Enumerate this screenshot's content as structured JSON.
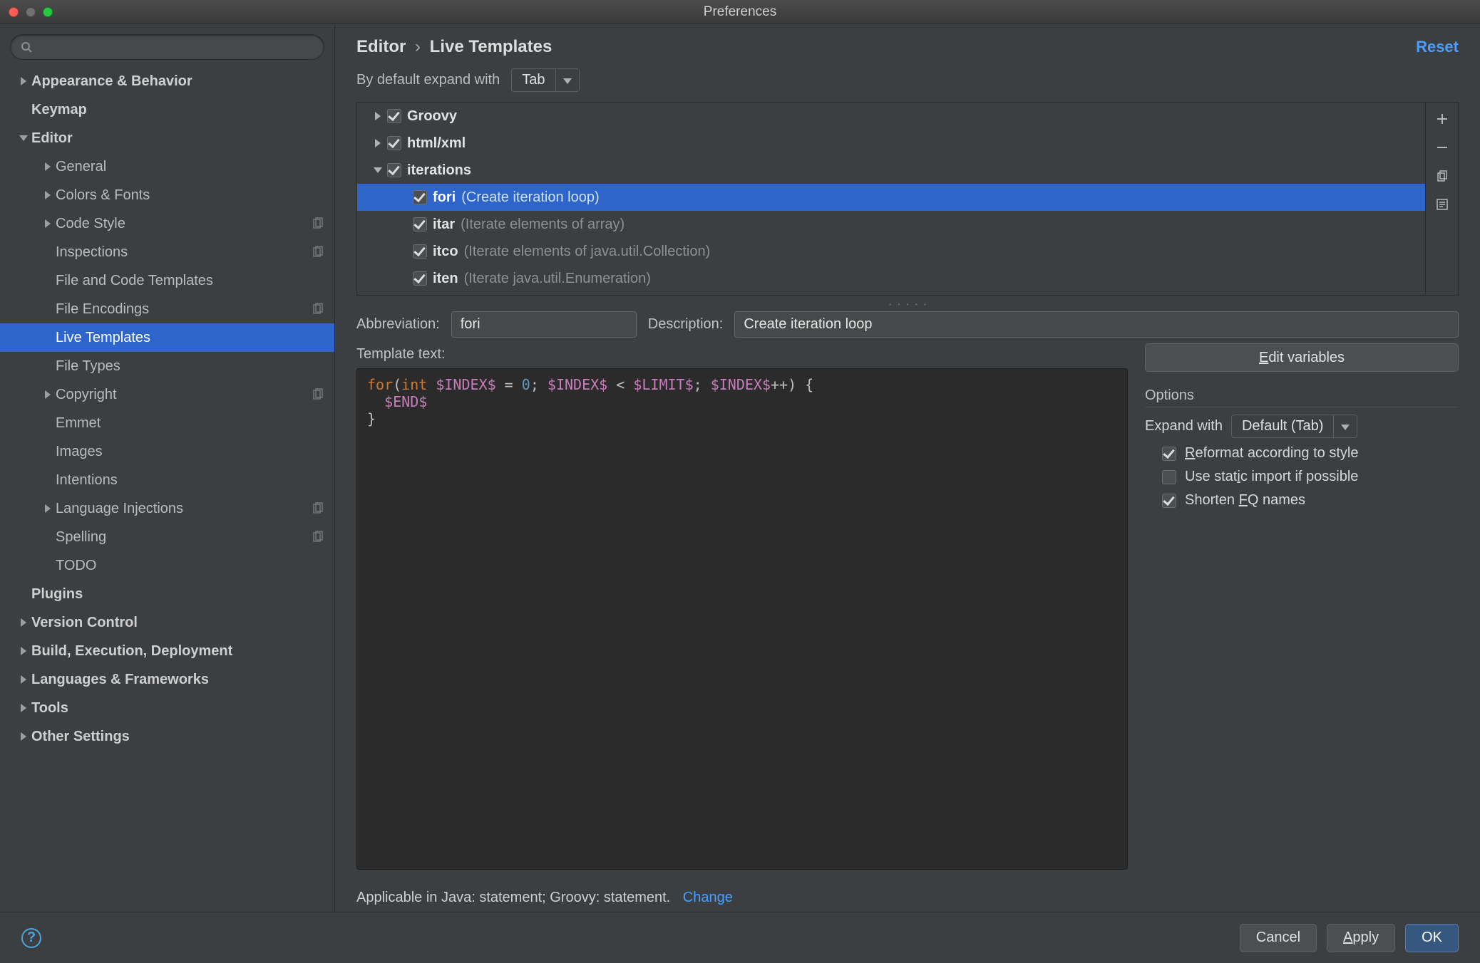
{
  "window": {
    "title": "Preferences"
  },
  "sidebar": {
    "groups": [
      {
        "label": "Appearance & Behavior",
        "indent": 0,
        "arrow": "right",
        "bold": true
      },
      {
        "label": "Keymap",
        "indent": 0,
        "arrow": "",
        "bold": true
      },
      {
        "label": "Editor",
        "indent": 0,
        "arrow": "down",
        "bold": true
      },
      {
        "label": "General",
        "indent": 1,
        "arrow": "right"
      },
      {
        "label": "Colors & Fonts",
        "indent": 1,
        "arrow": "right"
      },
      {
        "label": "Code Style",
        "indent": 1,
        "arrow": "right",
        "trailing": true
      },
      {
        "label": "Inspections",
        "indent": 1,
        "arrow": "",
        "trailing": true
      },
      {
        "label": "File and Code Templates",
        "indent": 1,
        "arrow": ""
      },
      {
        "label": "File Encodings",
        "indent": 1,
        "arrow": "",
        "trailing": true
      },
      {
        "label": "Live Templates",
        "indent": 1,
        "arrow": "",
        "selected": true
      },
      {
        "label": "File Types",
        "indent": 1,
        "arrow": ""
      },
      {
        "label": "Copyright",
        "indent": 1,
        "arrow": "right",
        "trailing": true
      },
      {
        "label": "Emmet",
        "indent": 1,
        "arrow": ""
      },
      {
        "label": "Images",
        "indent": 1,
        "arrow": ""
      },
      {
        "label": "Intentions",
        "indent": 1,
        "arrow": ""
      },
      {
        "label": "Language Injections",
        "indent": 1,
        "arrow": "right",
        "trailing": true
      },
      {
        "label": "Spelling",
        "indent": 1,
        "arrow": "",
        "trailing": true
      },
      {
        "label": "TODO",
        "indent": 1,
        "arrow": ""
      },
      {
        "label": "Plugins",
        "indent": 0,
        "arrow": "",
        "bold": true
      },
      {
        "label": "Version Control",
        "indent": 0,
        "arrow": "right",
        "bold": true
      },
      {
        "label": "Build, Execution, Deployment",
        "indent": 0,
        "arrow": "right",
        "bold": true
      },
      {
        "label": "Languages & Frameworks",
        "indent": 0,
        "arrow": "right",
        "bold": true
      },
      {
        "label": "Tools",
        "indent": 0,
        "arrow": "right",
        "bold": true
      },
      {
        "label": "Other Settings",
        "indent": 0,
        "arrow": "right",
        "bold": true
      }
    ]
  },
  "header": {
    "breadcrumb": [
      "Editor",
      "Live Templates"
    ],
    "reset": "Reset"
  },
  "expand": {
    "label": "By default expand with",
    "value": "Tab"
  },
  "templates": {
    "groups": [
      {
        "name": "Groovy",
        "arrow": "right",
        "checked": true
      },
      {
        "name": "html/xml",
        "arrow": "right",
        "checked": true
      },
      {
        "name": "iterations",
        "arrow": "down",
        "checked": true,
        "items": [
          {
            "abbr": "fori",
            "desc": "(Create iteration loop)",
            "checked": true,
            "selected": true
          },
          {
            "abbr": "itar",
            "desc": "(Iterate elements of array)",
            "checked": true
          },
          {
            "abbr": "itco",
            "desc": "(Iterate elements of java.util.Collection)",
            "checked": true
          },
          {
            "abbr": "iten",
            "desc": "(Iterate java.util.Enumeration)",
            "checked": true
          }
        ]
      }
    ]
  },
  "form": {
    "abbrev_label": "Abbreviation:",
    "abbrev_value": "fori",
    "desc_label": "Description:",
    "desc_value": "Create iteration loop"
  },
  "template_text": {
    "label": "Template text:",
    "lines": {
      "l1_kw1": "for",
      "l1_p1": "(",
      "l1_kw2": "int",
      "l1_sp": " ",
      "l1_v1": "$INDEX$",
      "l1_eq": " = ",
      "l1_num": "0",
      "l1_p2": "; ",
      "l1_v2": "$INDEX$",
      "l1_lt": " < ",
      "l1_v3": "$LIMIT$",
      "l1_p3": "; ",
      "l1_v4": "$INDEX$",
      "l1_inc": "++) {",
      "l2_indent": "  ",
      "l2_v": "$END$",
      "l3": "}"
    }
  },
  "right": {
    "edit_vars": "Edit variables",
    "options_title": "Options",
    "expand_with_label": "Expand with",
    "expand_with_value": "Default (Tab)",
    "reformat": "Reformat according to style",
    "static_import": "Use static import if possible",
    "shorten_fq": "Shorten FQ names",
    "checks": {
      "reformat": true,
      "static_import": false,
      "shorten_fq": true
    }
  },
  "applicable": {
    "text": "Applicable in Java: statement; Groovy: statement.",
    "change": "Change"
  },
  "footer": {
    "cancel": "Cancel",
    "apply": "Apply",
    "ok": "OK"
  }
}
